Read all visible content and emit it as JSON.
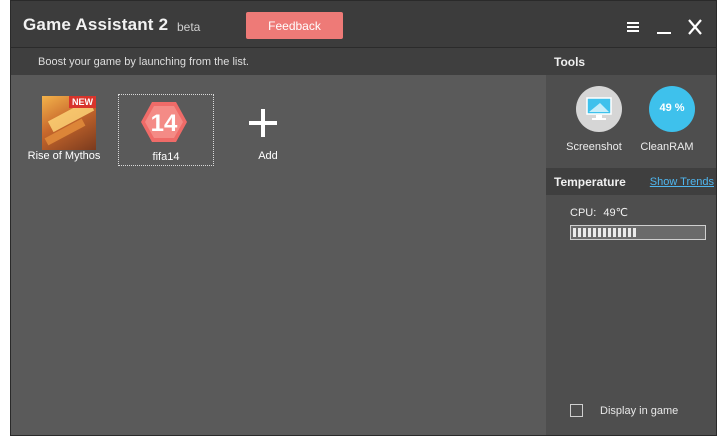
{
  "window": {
    "title": "Game Assistant 2",
    "beta": "beta",
    "feedback_label": "Feedback"
  },
  "main": {
    "hint": "Boost your game by launching from the list.",
    "games": [
      {
        "label": "Rise of Mythos",
        "badge": "NEW",
        "icon": "rise-of-mythos-game-icon"
      },
      {
        "label": "fifa14",
        "icon_text": "14",
        "icon": "fifa14-game-icon"
      }
    ],
    "add_label": "Add"
  },
  "sidebar": {
    "tools_title": "Tools",
    "tools": [
      {
        "label": "Screenshot",
        "icon": "screenshot-icon"
      },
      {
        "label": "CleanRAM",
        "icon": "clean-ram-icon",
        "value": "49 %"
      }
    ],
    "temperature_title": "Temperature",
    "show_trends": "Show Trends",
    "cpu_label": "CPU:",
    "cpu_value": "49℃",
    "cpu_level": 0.49,
    "display_in_game": "Display in game"
  },
  "colors": {
    "accent_feedback": "#ee7a77",
    "clean_ram": "#3ec1ec",
    "link": "#4fb6ef",
    "fifa_badge": "#ef6b68"
  }
}
